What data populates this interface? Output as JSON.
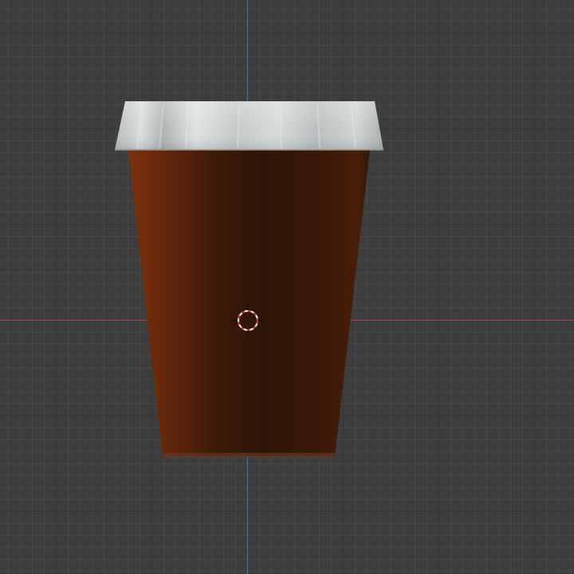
{
  "viewport": {
    "background": "#3d3d3d",
    "grid_minor_color": "#474747",
    "grid_major_color": "#333333",
    "x_axis_color": "#b2434a",
    "y_axis_color": "#4a6fb8",
    "grid_visible": true
  },
  "object": {
    "type": "paper coffee cup",
    "body_color": "#5a2208",
    "body_shadow_color": "#2e1408",
    "lid_color": "#c9cfcf"
  },
  "cursor": {
    "icon": "3d-cursor-icon",
    "ring_colors": [
      "#ffffff",
      "#c83232"
    ]
  }
}
